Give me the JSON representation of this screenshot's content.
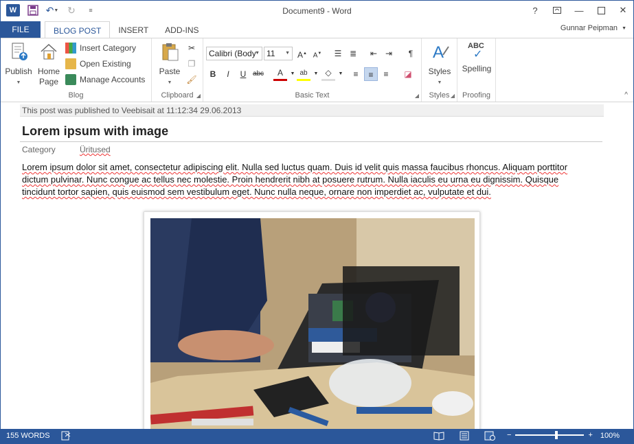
{
  "window": {
    "title": "Document9 - Word",
    "user": "Gunnar Peipman",
    "accent": "#2b579a"
  },
  "qat": {
    "app_icon": "W"
  },
  "tabs": {
    "file": "FILE",
    "items": [
      "BLOG POST",
      "INSERT",
      "ADD-INS"
    ]
  },
  "ribbon": {
    "blog": {
      "label": "Blog",
      "publish": "Publish",
      "home_page_1": "Home",
      "home_page_2": "Page",
      "insert_category": "Insert Category",
      "open_existing": "Open Existing",
      "manage_accounts": "Manage Accounts"
    },
    "clipboard": {
      "label": "Clipboard",
      "paste": "Paste"
    },
    "basic_text": {
      "label": "Basic Text",
      "font": "Calibri (Body",
      "size": "11"
    },
    "styles": {
      "label": "Styles",
      "button": "Styles"
    },
    "proofing": {
      "label": "Proofing",
      "button": "Spelling",
      "abc": "ABC"
    }
  },
  "document": {
    "published_notice": "This post was published to Veebisait at 11:12:34 29.06.2013",
    "post_title": "Lorem ipsum with image",
    "category_label": "Category",
    "category_value": "Üritused",
    "body_line1": "Lorem ipsum dolor sit amet, consectetur adipiscing elit. Nulla sed luctus quam. Duis id velit quis massa faucibus rhoncus. Aliquam porttitor",
    "body_line2": "dictum pulvinar. Nunc congue ac tellus nec molestie. Proin hendrerit nibh at posuere rutrum. Nulla iaculis eu urna eu dignissim. Quisque",
    "body_line3": "tincidunt tortor sapien, quis euismod sem vestibulum eget. Nunc nulla neque, ornare non imperdiet ac, vulputate et dui."
  },
  "status": {
    "words": "155 WORDS",
    "zoom": "100%",
    "zoom_level_fraction": 0.5
  }
}
